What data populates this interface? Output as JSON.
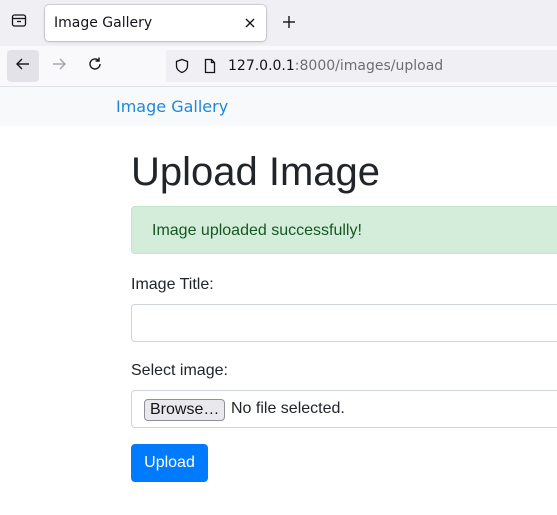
{
  "browser": {
    "tab": {
      "title": "Image Gallery"
    },
    "url": {
      "host": "127.0.0.1",
      "rest": ":8000/images/upload"
    }
  },
  "navbar": {
    "brand": "Image Gallery"
  },
  "main": {
    "heading": "Upload Image",
    "alert": "Image uploaded successfully!",
    "title_label": "Image Title:",
    "title_value": "",
    "file_label": "Select image:",
    "browse_label": "Browse…",
    "file_status": "No file selected.",
    "submit_label": "Upload"
  },
  "colors": {
    "brand": "#1f87d8",
    "primary": "#007bff",
    "alert_bg": "#d4edda",
    "alert_text": "#155724"
  }
}
